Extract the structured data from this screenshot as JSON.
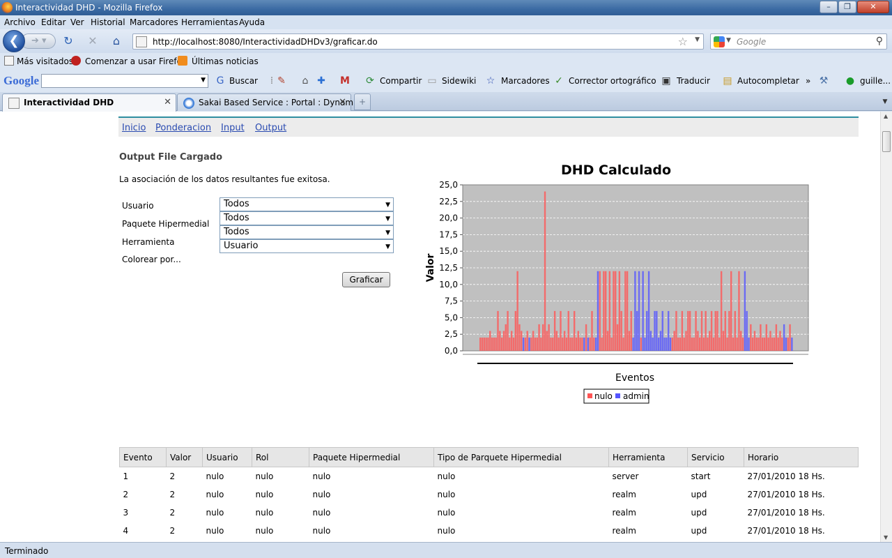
{
  "window": {
    "title": "Interactividad DHD - Mozilla Firefox"
  },
  "menu": [
    "Archivo",
    "Editar",
    "Ver",
    "Historial",
    "Marcadores",
    "Herramientas",
    "Ayuda"
  ],
  "nav": {
    "url": "http://localhost:8080/InteractividadDHDv3/graficar.do",
    "search_placeholder": "Google"
  },
  "bookmarks": [
    "Más visitados",
    "Comenzar a usar Firefox",
    "Últimas noticias"
  ],
  "google_toolbar": {
    "logo": "Google",
    "items": [
      "Buscar",
      "Compartir",
      "Sidewiki",
      "Marcadores",
      "Corrector ortográfico",
      "Traducir",
      "Autocompletar",
      "»",
      "guille..."
    ]
  },
  "tabs": [
    {
      "label": "Interactividad DHD",
      "active": true
    },
    {
      "label": "Sakai Based Service : Portal : Dynam...",
      "active": false
    }
  ],
  "page": {
    "nav_links": [
      "Inicio",
      "Ponderacion",
      "Input",
      "Output"
    ],
    "heading": "Output File Cargado",
    "message": "La asociación de los datos resultantes fue exitosa.",
    "form": {
      "fields": [
        {
          "label": "Usuario",
          "value": "Todos"
        },
        {
          "label": "Paquete Hipermedial",
          "value": "Todos"
        },
        {
          "label": "Herramienta",
          "value": "Todos"
        },
        {
          "label": "Colorear por...",
          "value": "Usuario"
        }
      ],
      "submit": "Graficar"
    }
  },
  "chart_data": {
    "type": "bar",
    "title": "DHD Calculado",
    "xlabel": "Eventos",
    "ylabel": "Valor",
    "ylim": [
      0,
      25
    ],
    "y_ticks": [
      "0,0",
      "2,5",
      "5,0",
      "7,5",
      "10,0",
      "12,5",
      "15,0",
      "17,5",
      "20,0",
      "22,5",
      "25,0"
    ],
    "grid": true,
    "legend_placement": "bottom",
    "series": [
      {
        "name": "nulo",
        "color": "#ff5555"
      },
      {
        "name": "admin",
        "color": "#5555ff"
      }
    ],
    "event_count": 160,
    "values": [
      2,
      2,
      2,
      2,
      2,
      3,
      2,
      2,
      2,
      6,
      3,
      2,
      3,
      4,
      6,
      2,
      3,
      2,
      6,
      12,
      4,
      3,
      2,
      2,
      3,
      2,
      2,
      3,
      2,
      2,
      4,
      2,
      4,
      24,
      3,
      4,
      2,
      2,
      6,
      3,
      2,
      6,
      2,
      3,
      2,
      6,
      2,
      2,
      6,
      2,
      3,
      2,
      2,
      2,
      4,
      2,
      2,
      6,
      2,
      2,
      12,
      12,
      2,
      12,
      12,
      3,
      12,
      2,
      12,
      12,
      4,
      12,
      6,
      2,
      12,
      12,
      3,
      6,
      2,
      12,
      6,
      12,
      2,
      12,
      2,
      6,
      12,
      3,
      2,
      6,
      6,
      2,
      3,
      6,
      2,
      2,
      6,
      2,
      2,
      3,
      6,
      2,
      2,
      6,
      2,
      3,
      6,
      6,
      2,
      2,
      6,
      3,
      2,
      6,
      2,
      6,
      2,
      3,
      6,
      2,
      6,
      6,
      2,
      12,
      3,
      6,
      2,
      6,
      12,
      2,
      6,
      2,
      12,
      3,
      2,
      12,
      6,
      2,
      4,
      2,
      3,
      2,
      2,
      4,
      2,
      2,
      4,
      2,
      3,
      2,
      2,
      4,
      2,
      3,
      2,
      4,
      2,
      2,
      4,
      2
    ],
    "series_index": [
      0,
      0,
      0,
      0,
      0,
      0,
      0,
      0,
      0,
      0,
      0,
      0,
      0,
      0,
      0,
      0,
      0,
      0,
      0,
      0,
      0,
      0,
      1,
      0,
      0,
      1,
      0,
      0,
      0,
      0,
      0,
      0,
      0,
      0,
      0,
      0,
      0,
      0,
      0,
      0,
      0,
      0,
      0,
      0,
      0,
      0,
      0,
      0,
      0,
      0,
      0,
      0,
      0,
      1,
      0,
      1,
      0,
      0,
      0,
      1,
      1,
      0,
      0,
      0,
      0,
      0,
      0,
      0,
      0,
      0,
      0,
      0,
      0,
      0,
      0,
      0,
      0,
      0,
      1,
      1,
      1,
      1,
      0,
      1,
      1,
      1,
      1,
      1,
      1,
      1,
      1,
      1,
      1,
      1,
      1,
      1,
      1,
      1,
      0,
      0,
      0,
      0,
      0,
      0,
      0,
      0,
      0,
      0,
      0,
      0,
      0,
      0,
      0,
      0,
      0,
      0,
      0,
      0,
      0,
      0,
      0,
      0,
      0,
      0,
      0,
      0,
      0,
      0,
      0,
      0,
      0,
      0,
      0,
      0,
      0,
      1,
      1,
      1,
      0,
      0,
      0,
      0,
      0,
      0,
      0,
      0,
      0,
      0,
      0,
      0,
      0,
      0,
      0,
      0,
      0,
      1,
      1,
      0,
      0,
      1
    ]
  },
  "table": {
    "headers": [
      "Evento",
      "Valor",
      "Usuario",
      "Rol",
      "Paquete Hipermedial",
      "Tipo de Parquete Hipermedial",
      "Herramienta",
      "Servicio",
      "Horario"
    ],
    "rows": [
      [
        "1",
        "2",
        "nulo",
        "nulo",
        "nulo",
        "nulo",
        "server",
        "start",
        "27/01/2010 18 Hs."
      ],
      [
        "2",
        "2",
        "nulo",
        "nulo",
        "nulo",
        "nulo",
        "realm",
        "upd",
        "27/01/2010 18 Hs."
      ],
      [
        "3",
        "2",
        "nulo",
        "nulo",
        "nulo",
        "nulo",
        "realm",
        "upd",
        "27/01/2010 18 Hs."
      ],
      [
        "4",
        "2",
        "nulo",
        "nulo",
        "nulo",
        "nulo",
        "realm",
        "upd",
        "27/01/2010 18 Hs."
      ]
    ]
  },
  "status": "Terminado"
}
